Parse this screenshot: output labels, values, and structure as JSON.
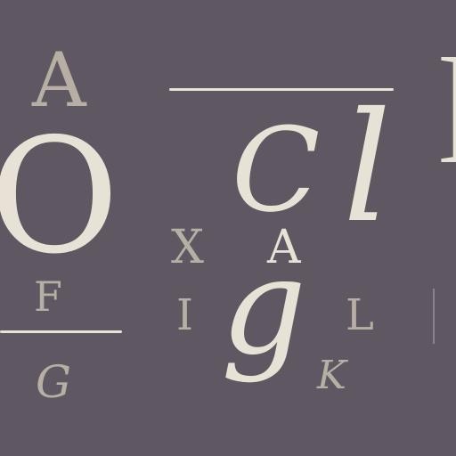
{
  "glyphs": {
    "a_top": "A",
    "o_big": "O",
    "c_big": "C",
    "l_script": "l",
    "l_right": "l",
    "x_mid": "X",
    "a_mid": "A",
    "f_left": "F",
    "i_mid": "I",
    "g_script": "g",
    "l_mid": "L",
    "g_small": "G",
    "k_small": "K"
  },
  "colors": {
    "background": "#5f5862",
    "cream": "#e8e2d6",
    "taupe": "#b7afa3"
  }
}
